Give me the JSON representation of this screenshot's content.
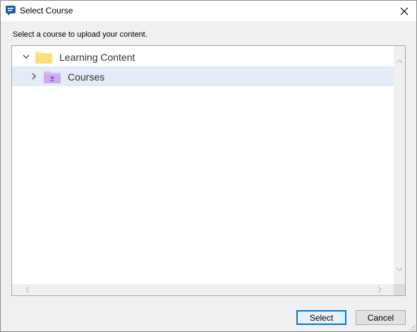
{
  "window": {
    "title": "Select Course"
  },
  "instruction": "Select a course to upload your content.",
  "tree": {
    "root": {
      "label": "Learning Content",
      "expanded": true,
      "icon": "folder-icon"
    },
    "child": {
      "label": "Courses",
      "expanded": false,
      "selected": true,
      "icon": "course-folder-icon"
    }
  },
  "buttons": {
    "select": "Select",
    "cancel": "Cancel"
  },
  "colors": {
    "selection": "#e3ebf7",
    "folder": "#fde58c",
    "course_folder": "#d6b8f5",
    "primary_border": "#0078d7"
  }
}
